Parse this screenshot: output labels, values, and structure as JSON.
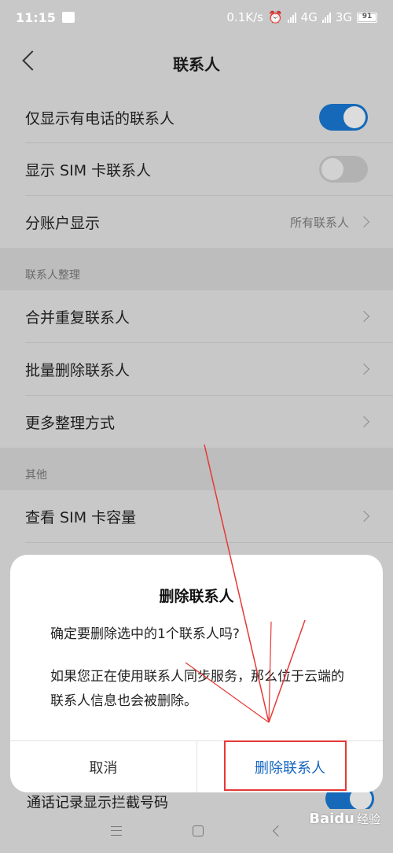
{
  "status_bar": {
    "time": "11:15",
    "net_speed": "0.1K/s",
    "sim1_type": "4G",
    "sim2_type": "3G",
    "battery": "91"
  },
  "header": {
    "title": "联系人"
  },
  "settings": {
    "phone_only": {
      "label": "仅显示有电话的联系人",
      "toggle": "on"
    },
    "sim_contacts": {
      "label": "显示 SIM 卡联系人",
      "toggle": "off"
    },
    "account_display": {
      "label": "分账户显示",
      "value": "所有联系人"
    },
    "organize_section": "联系人整理",
    "merge": "合并重复联系人",
    "batch_delete": "批量删除联系人",
    "more_ways": "更多整理方式",
    "other_section": "其他",
    "sim_capacity": "查看 SIM 卡容量",
    "partial_row": "通话记录显示拦截号码"
  },
  "dialog": {
    "title": "删除联系人",
    "message_1": "确定要删除选中的1个联系人吗?",
    "message_2": "如果您正在使用联系人同步服务，那么位于云端的联系人信息也会被删除。",
    "cancel_label": "取消",
    "confirm_label": "删除联系人"
  },
  "watermark": {
    "brand": "Baidu",
    "sub": "经验"
  },
  "colors": {
    "accent": "#1569b8",
    "confirm": "#1565c0",
    "annotation": "#e53935"
  }
}
